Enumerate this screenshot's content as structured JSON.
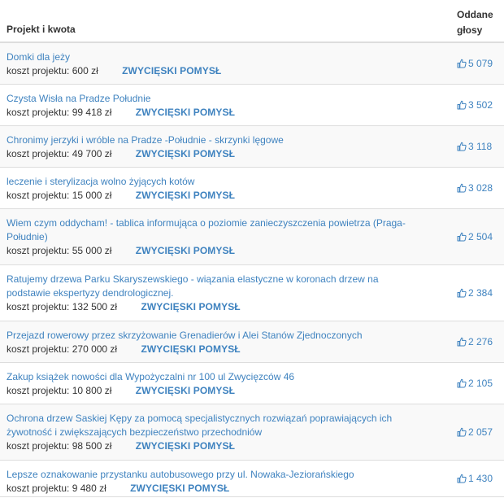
{
  "header": {
    "project_col": "Projekt i kwota",
    "votes_col_line1": "Oddane",
    "votes_col_line2": "głosy"
  },
  "rows": [
    {
      "title": "Domki dla jeży",
      "cost_label": "koszt projektu:",
      "cost": "600 zł",
      "badge": "ZWYCIĘSKI POMYSŁ",
      "votes": "5 079"
    },
    {
      "title": "Czysta Wisła na Pradze Południe",
      "cost_label": "koszt projektu:",
      "cost": "99 418 zł",
      "badge": "ZWYCIĘSKI POMYSŁ",
      "votes": "3 502"
    },
    {
      "title": "Chronimy jerzyki i wróble na Pradze -Południe - skrzynki lęgowe",
      "cost_label": "koszt projektu:",
      "cost": "49 700 zł",
      "badge": "ZWYCIĘSKI POMYSŁ",
      "votes": "3 118"
    },
    {
      "title": "leczenie i sterylizacja wolno żyjących kotów",
      "cost_label": "koszt projektu:",
      "cost": "15 000 zł",
      "badge": "ZWYCIĘSKI POMYSŁ",
      "votes": "3 028"
    },
    {
      "title": "Wiem czym oddycham! - tablica informująca o poziomie zanieczyszczenia powietrza (Praga-Południe)",
      "cost_label": "koszt projektu:",
      "cost": "55 000 zł",
      "badge": "ZWYCIĘSKI POMYSŁ",
      "votes": "2 504"
    },
    {
      "title": "Ratujemy drzewa Parku Skaryszewskiego - wiązania elastyczne w koronach drzew na podstawie ekspertyzy dendrologicznej.",
      "cost_label": "koszt projektu:",
      "cost": "132 500 zł",
      "badge": "ZWYCIĘSKI POMYSŁ",
      "votes": "2 384"
    },
    {
      "title": "Przejazd rowerowy przez skrzyżowanie Grenadierów i Alei Stanów Zjednoczonych",
      "cost_label": "koszt projektu:",
      "cost": "270 000 zł",
      "badge": "ZWYCIĘSKI POMYSŁ",
      "votes": "2 276"
    },
    {
      "title": "Zakup książek nowości dla Wypożyczalni nr 100 ul Zwycięzców 46",
      "cost_label": "koszt projektu:",
      "cost": "10 800 zł",
      "badge": "ZWYCIĘSKI POMYSŁ",
      "votes": "2 105"
    },
    {
      "title": "Ochrona drzew Saskiej Kępy za pomocą specjalistycznych rozwiązań poprawiających ich żywotność i zwiększających bezpieczeństwo przechodniów",
      "cost_label": "koszt projektu:",
      "cost": "98 500 zł",
      "badge": "ZWYCIĘSKI POMYSŁ",
      "votes": "2 057"
    },
    {
      "title": "Lepsze oznakowanie przystanku autobusowego przy ul. Nowaka-Jeziorańskiego",
      "cost_label": "koszt projektu:",
      "cost": "9 480 zł",
      "badge": "ZWYCIĘSKI POMYSŁ",
      "votes": "1 430"
    }
  ],
  "icons": {
    "votes_icon": "thumbs-up-icon"
  },
  "colors": {
    "link": "#3e82bf",
    "text": "#333333",
    "row_bg": "#f9f9f9",
    "border": "#dddddd"
  }
}
